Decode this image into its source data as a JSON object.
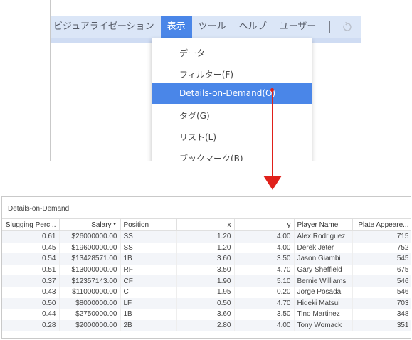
{
  "menubar": {
    "items": [
      {
        "label": "ビジュアライゼーション"
      },
      {
        "label": "表示"
      },
      {
        "label": "ツール"
      },
      {
        "label": "ヘルプ"
      },
      {
        "label": "ユーザー"
      }
    ],
    "active_index": 1
  },
  "dropdown": {
    "items": [
      {
        "label": "データ"
      },
      {
        "label": "フィルター(F)"
      },
      {
        "label": "Details-on-Demand(O)"
      },
      {
        "label": "タグ(G)"
      },
      {
        "label": "リスト(L)"
      },
      {
        "label": "ブックマーク(B)"
      }
    ],
    "selected_index": 2
  },
  "colors": {
    "accent": "#4a86e8",
    "menubar_bg": "#dbe6f7",
    "arrow": "#e0201a",
    "row_alt": "#f3f5f9"
  },
  "panel": {
    "title": "Details-on-Demand",
    "columns": [
      {
        "label": "Slugging Perc...",
        "align": "right"
      },
      {
        "label": "Salary",
        "align": "right",
        "sorted": "descending"
      },
      {
        "label": "Position",
        "align": "left"
      },
      {
        "label": "x",
        "align": "right"
      },
      {
        "label": "y",
        "align": "right"
      },
      {
        "label": "Player Name",
        "align": "left"
      },
      {
        "label": "Plate Appeare...",
        "align": "right"
      }
    ],
    "rows": [
      [
        "0.61",
        "$26000000.00",
        "SS",
        "1.20",
        "4.00",
        "Alex Rodriguez",
        "715"
      ],
      [
        "0.45",
        "$19600000.00",
        "SS",
        "1.20",
        "4.00",
        "Derek Jeter",
        "752"
      ],
      [
        "0.54",
        "$13428571.00",
        "1B",
        "3.60",
        "3.50",
        "Jason Giambi",
        "545"
      ],
      [
        "0.51",
        "$13000000.00",
        "RF",
        "3.50",
        "4.70",
        "Gary Sheffield",
        "675"
      ],
      [
        "0.37",
        "$12357143.00",
        "CF",
        "1.90",
        "5.10",
        "Bernie Williams",
        "546"
      ],
      [
        "0.43",
        "$11000000.00",
        "C",
        "1.95",
        "0.20",
        "Jorge Posada",
        "546"
      ],
      [
        "0.50",
        "$8000000.00",
        "LF",
        "0.50",
        "4.70",
        "Hideki Matsui",
        "703"
      ],
      [
        "0.44",
        "$2750000.00",
        "1B",
        "3.60",
        "3.50",
        "Tino Martinez",
        "348"
      ],
      [
        "0.28",
        "$2000000.00",
        "2B",
        "2.80",
        "4.00",
        "Tony Womack",
        "351"
      ]
    ]
  }
}
